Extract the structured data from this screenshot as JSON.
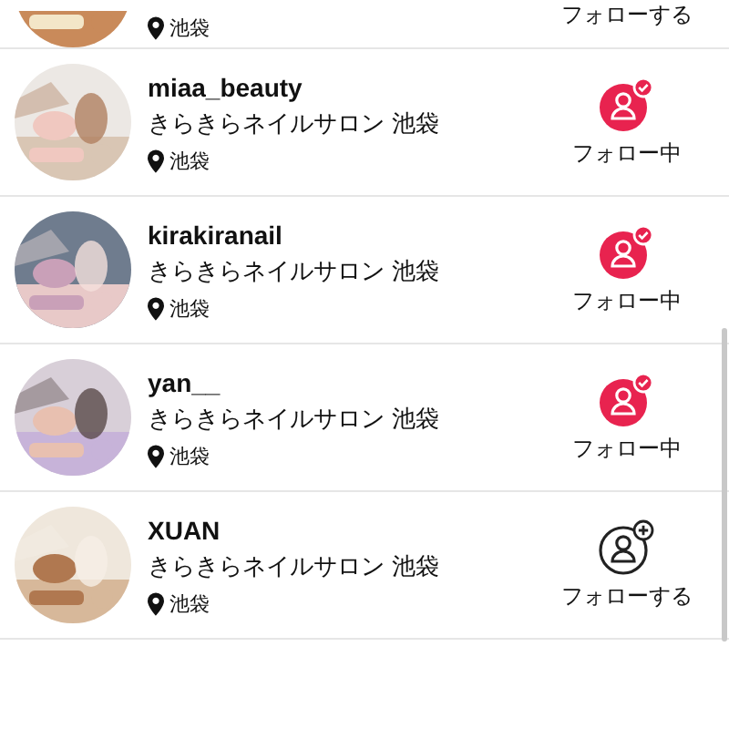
{
  "users": [
    {
      "location": "池袋",
      "follow_label": "フォローする"
    },
    {
      "name": "miaa_beauty",
      "salon": "きらきらネイルサロン 池袋",
      "location": "池袋",
      "following": true,
      "follow_label": "フォロー中"
    },
    {
      "name": "kirakiranail",
      "salon": "きらきらネイルサロン 池袋",
      "location": "池袋",
      "following": true,
      "follow_label": "フォロー中"
    },
    {
      "name": "yan__",
      "salon": "きらきらネイルサロン 池袋",
      "location": "池袋",
      "following": true,
      "follow_label": "フォロー中"
    },
    {
      "name": "XUAN",
      "salon": "きらきらネイルサロン 池袋",
      "location": "池袋",
      "following": false,
      "follow_label": "フォローする"
    }
  ]
}
